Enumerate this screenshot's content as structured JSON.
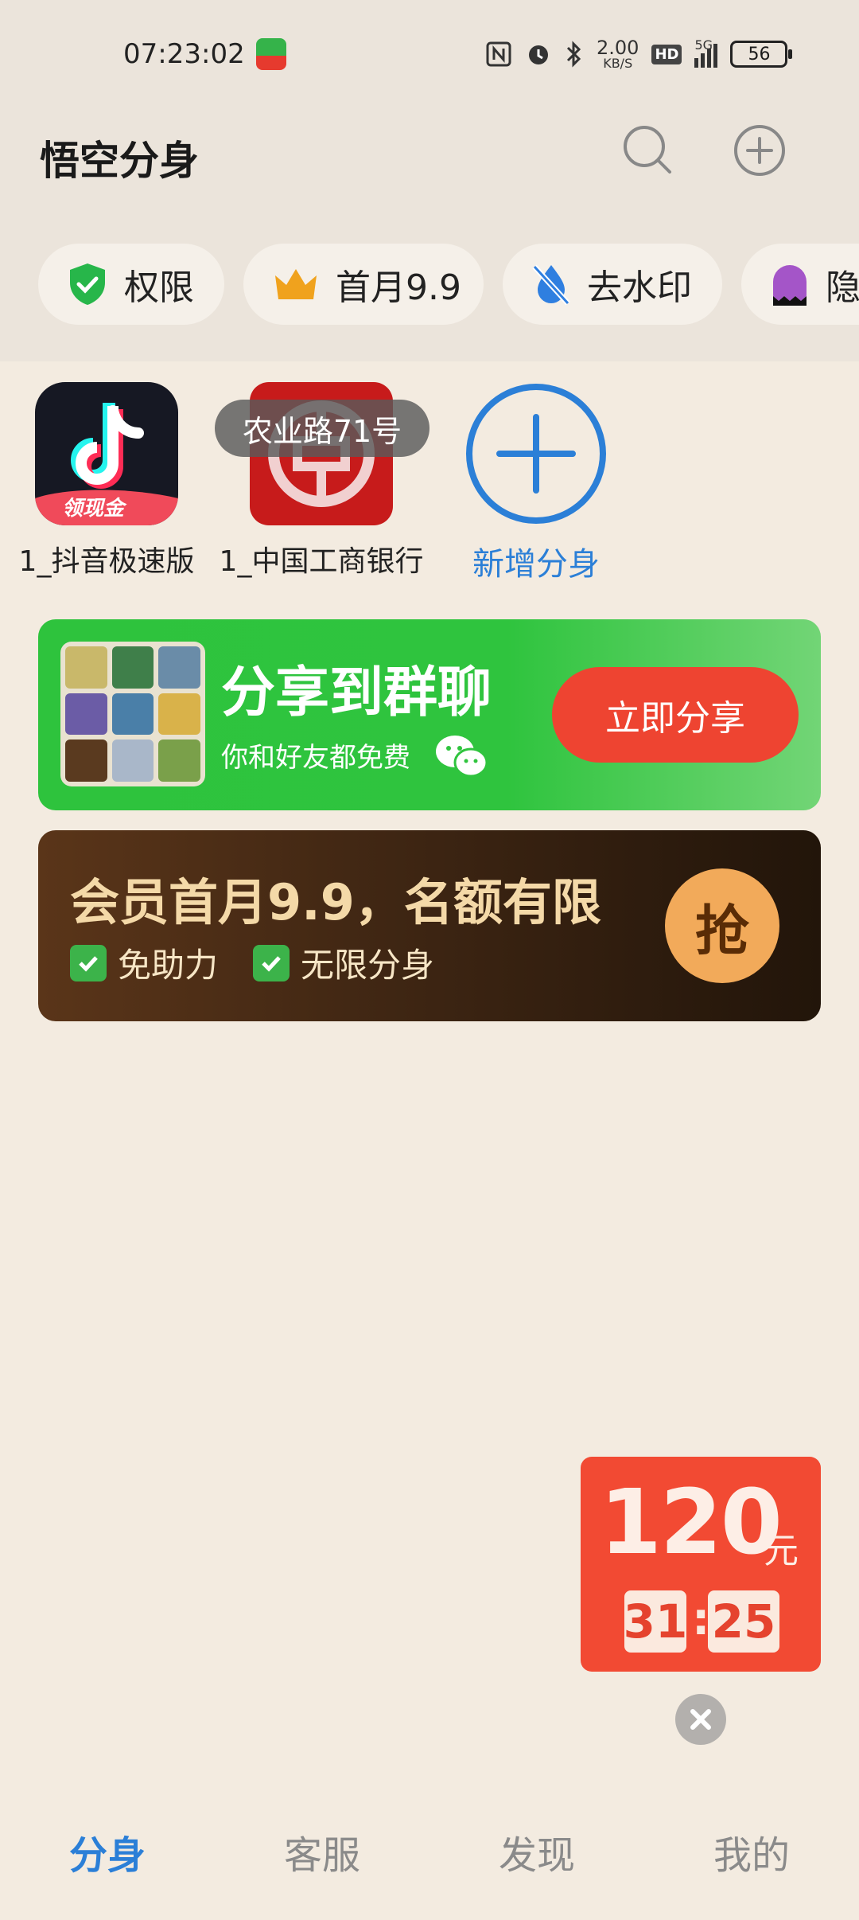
{
  "status_bar": {
    "time": "07:23:02",
    "net_speed_value": "2.00",
    "net_speed_unit": "KB/S",
    "hd_badge": "HD",
    "network": "5G",
    "battery": "56"
  },
  "header": {
    "title": "悟空分身"
  },
  "chips": [
    {
      "label": "权限",
      "icon": "shield-check-icon"
    },
    {
      "label": "首月9.9",
      "icon": "crown-icon"
    },
    {
      "label": "去水印",
      "icon": "water-drop-off-icon"
    },
    {
      "label": "隐",
      "icon": "ghost-icon"
    }
  ],
  "shortcuts": [
    {
      "label": "1_抖音极速版",
      "badge": "领现金",
      "icon": "douyin-icon"
    },
    {
      "label": "1_中国工商银行",
      "icon": "icbc-icon"
    },
    {
      "label": "新增分身",
      "icon": "add-clone-icon"
    }
  ],
  "toast": "农业路71号",
  "share_banner": {
    "title": "分享到群聊",
    "subtitle": "你和好友都免费",
    "button": "立即分享"
  },
  "vip_banner": {
    "title": "会员首月9.9，名额有限",
    "features": [
      "免助力",
      "无限分身"
    ],
    "button": "抢"
  },
  "promo": {
    "amount": "120",
    "unit": "元",
    "minutes": "31",
    "seconds": "25",
    "separator": ":"
  },
  "nav": [
    {
      "label": "分身",
      "active": true
    },
    {
      "label": "客服",
      "active": false
    },
    {
      "label": "发现",
      "active": false
    },
    {
      "label": "我的",
      "active": false
    }
  ],
  "colors": {
    "accent_blue": "#2b7fd7",
    "share_green": "#2ec33d",
    "cta_red": "#ee4431",
    "vip_gold": "#f2aa5a",
    "background": "#f3ebe0"
  }
}
